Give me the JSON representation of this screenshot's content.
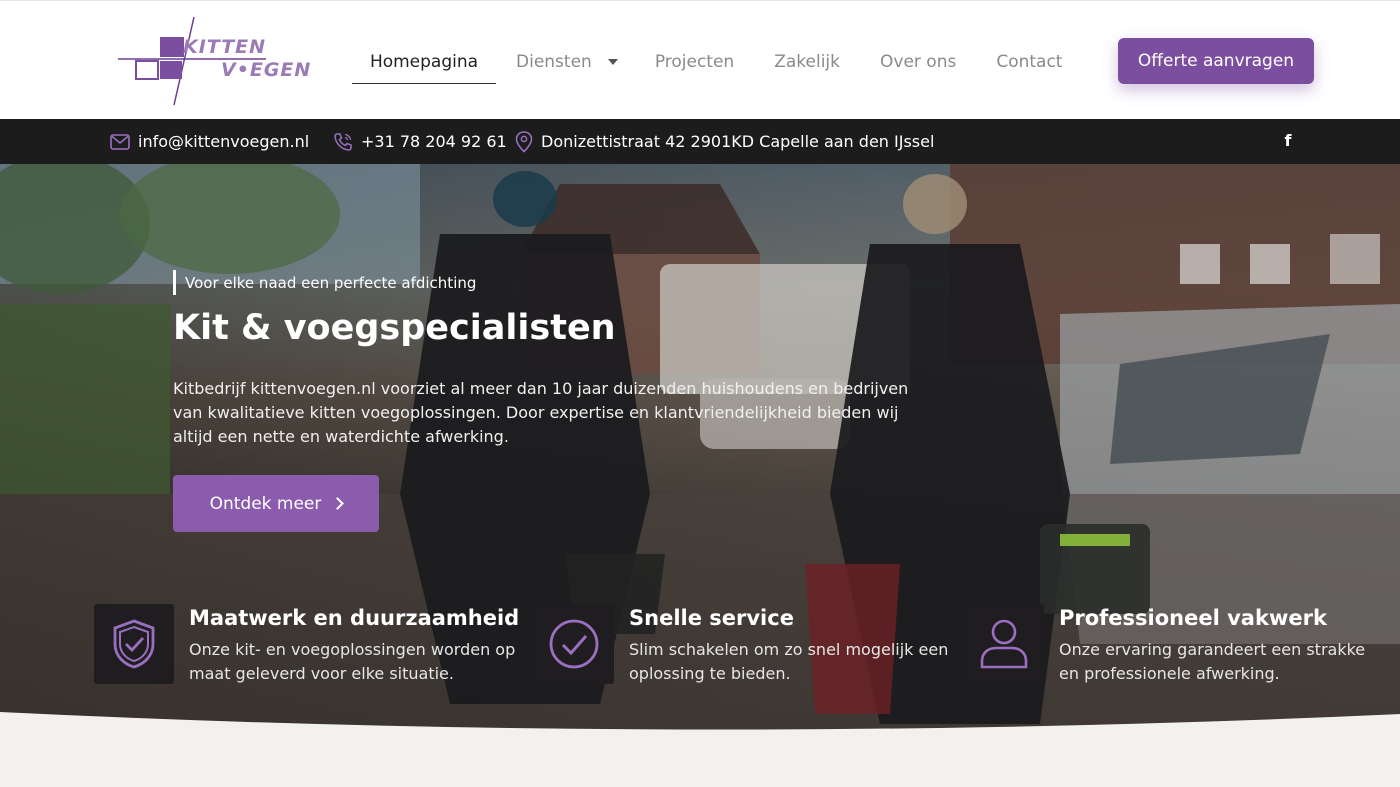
{
  "brand": {
    "logo_line1": "KITTEN",
    "logo_line2": "V•EGEN",
    "accent": "#7c4e9f"
  },
  "nav": {
    "items": [
      {
        "label": "Homepagina",
        "active": true
      },
      {
        "label": "Diensten",
        "dropdown": true
      },
      {
        "label": "Projecten"
      },
      {
        "label": "Zakelijk"
      },
      {
        "label": "Over ons"
      },
      {
        "label": "Contact"
      }
    ],
    "cta_label": "Offerte aanvragen"
  },
  "topbar": {
    "email": "info@kittenvoegen.nl",
    "phone": "+31 78 204 92 61",
    "address": "Donizettistraat 42 2901KD Capelle aan den IJssel",
    "social_icon": "facebook-icon",
    "social_glyph": "f"
  },
  "hero": {
    "kicker": "Voor elke naad een perfecte afdichting",
    "title": "Kit & voegspecialisten",
    "text": "Kitbedrijf kittenvoegen.nl voorziet al meer dan 10 jaar duizenden huishoudens en bedrijven van kwalitatieve kitten voegoplossingen. Door expertise en klantvriendelijkheid bieden wij altijd een nette en waterdichte afwerking.",
    "button_label": "Ontdek meer"
  },
  "features": [
    {
      "icon": "shield-check-icon",
      "title": "Maatwerk en duurzaamheid",
      "desc": "Onze kit- en voegoplossingen worden op maat geleverd voor elke situatie."
    },
    {
      "icon": "check-circle-icon",
      "title": "Snelle service",
      "desc": "Slim schakelen om zo snel mogelijk een oplossing te bieden."
    },
    {
      "icon": "user-icon",
      "title": "Professioneel vakwerk",
      "desc": "Onze ervaring garandeert een strakke en professionele afwerking."
    }
  ]
}
